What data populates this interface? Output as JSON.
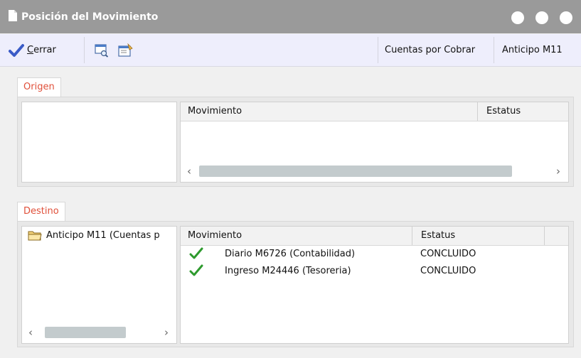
{
  "window": {
    "title": "Posición del Movimiento"
  },
  "toolbar": {
    "close_label_first": "C",
    "close_label_rest": "errar",
    "account_label": "Cuentas por Cobrar",
    "movement_label": "Anticipo M11"
  },
  "origen": {
    "tab_label": "Origen",
    "columns": [
      "Movimiento",
      "Estatus"
    ],
    "rows": []
  },
  "destino": {
    "tab_label": "Destino",
    "tree_item": "Anticipo M11 (Cuentas p",
    "columns": [
      "Movimiento",
      "Estatus"
    ],
    "rows": [
      {
        "movimiento": "Diario M6726 (Contabilidad)",
        "estatus": "CONCLUIDO"
      },
      {
        "movimiento": "Ingreso M24446 (Tesoreria)",
        "estatus": "CONCLUIDO"
      }
    ]
  },
  "icons": {
    "window": "document-icon",
    "close": "checkmark-icon",
    "toolbar2": "window-search-icon",
    "toolbar3": "properties-icon",
    "folder": "folder-icon",
    "row_status": "green-check-icon"
  },
  "colors": {
    "titlebar": "#9a9a9a",
    "toolbar_bg": "#eeeefc",
    "tab_text": "#e0503a",
    "check": "#2e9a2e"
  }
}
